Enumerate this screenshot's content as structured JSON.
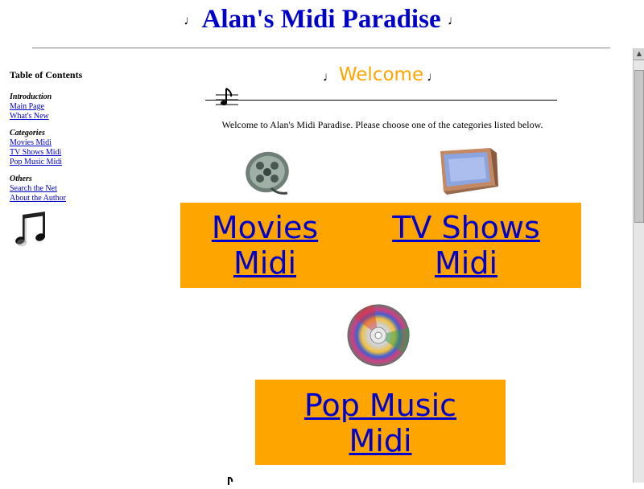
{
  "header": {
    "title": "Alan's Midi Paradise",
    "note_glyph": "♩"
  },
  "sidebar": {
    "toc_title": "Table of Contents",
    "sections": [
      {
        "heading": "Introduction",
        "links": [
          "Main Page",
          "What's New"
        ]
      },
      {
        "heading": "Categories",
        "links": [
          "Movies Midi",
          "TV Shows Midi",
          "Pop Music Midi"
        ]
      },
      {
        "heading": "Others",
        "links": [
          "Search the Net",
          "About the Author"
        ]
      }
    ]
  },
  "main": {
    "welcome_heading": "Welcome",
    "welcome_text": "Welcome to Alan's Midi Paradise. Please choose one of the categories listed below.",
    "categories": {
      "movies_line1": "Movies",
      "movies_line2": "Midi",
      "tv_line1": "TV Shows",
      "tv_line2": "Midi",
      "pop_line1": "Pop Music",
      "pop_line2": "Midi"
    }
  },
  "colors": {
    "title_blue": "#0000cc",
    "accent_orange": "#ffa500"
  }
}
